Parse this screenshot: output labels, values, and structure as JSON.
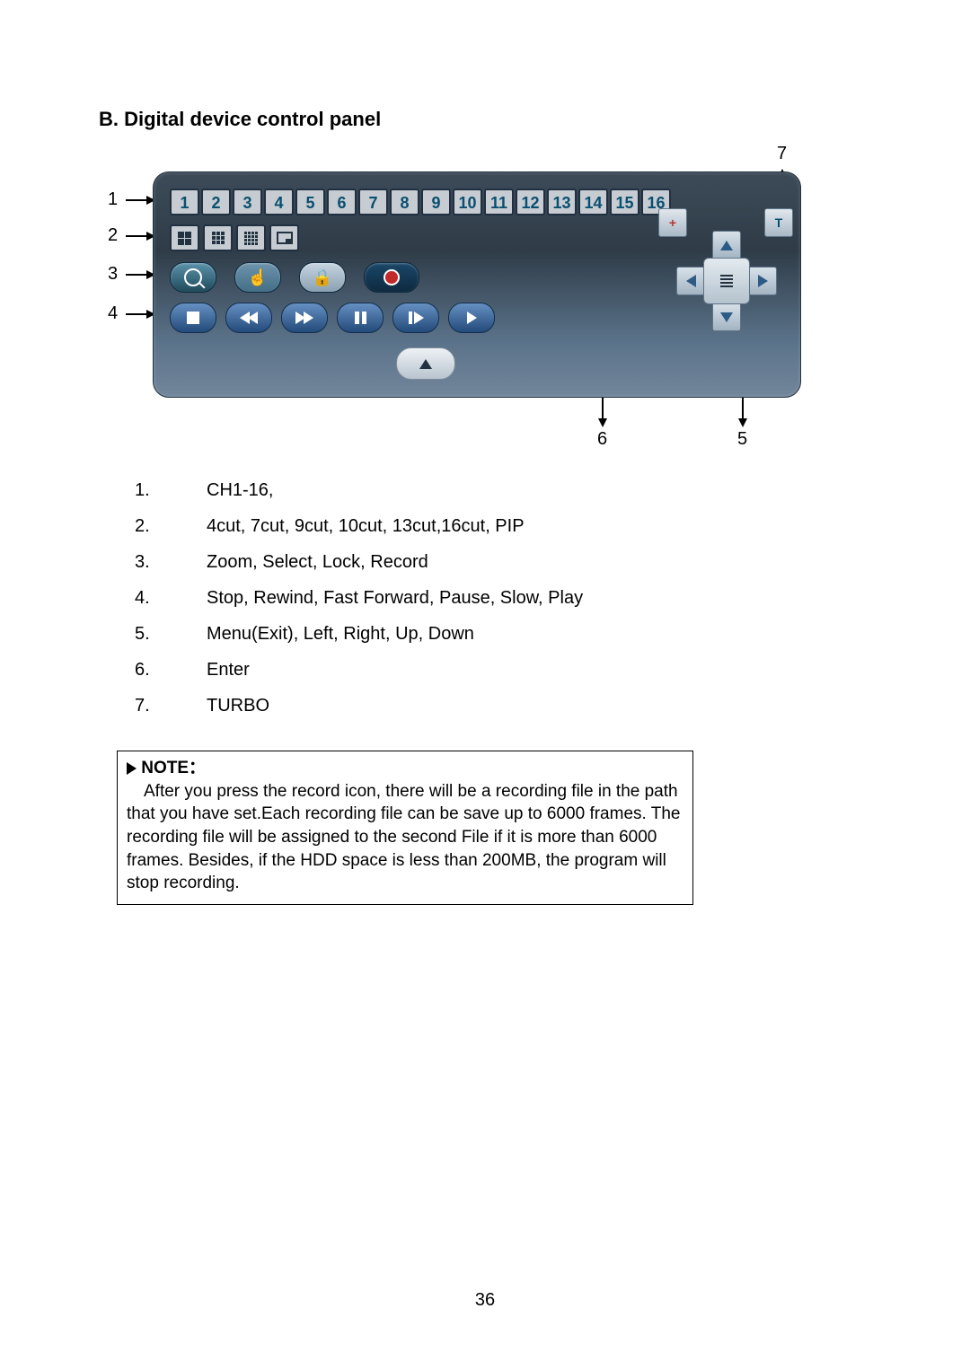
{
  "title": "B. Digital device control panel",
  "annotations": {
    "a1": "1",
    "a2": "2",
    "a3": "3",
    "a4": "4",
    "a5": "5",
    "a6": "6",
    "a7": "7"
  },
  "channels": [
    "1",
    "2",
    "3",
    "4",
    "5",
    "6",
    "7",
    "8",
    "9",
    "10",
    "11",
    "12",
    "13",
    "14",
    "15",
    "16"
  ],
  "turbo_label": "T",
  "plus_label": "+",
  "legend": [
    {
      "n": "1.",
      "t": "CH1-16,"
    },
    {
      "n": "2.",
      "t": "4cut, 7cut, 9cut, 10cut, 13cut,16cut, PIP"
    },
    {
      "n": "3.",
      "t": "Zoom, Select, Lock, Record"
    },
    {
      "n": "4.",
      "t": "Stop, Rewind, Fast Forward, Pause, Slow, Play"
    },
    {
      "n": "5.",
      "t": "Menu(Exit), Left, Right, Up, Down"
    },
    {
      "n": "6.",
      "t": "Enter"
    },
    {
      "n": "7.",
      "t": "TURBO"
    }
  ],
  "note_label": "NOTE：",
  "note_body": "After you press the record icon, there will be a recording file in the path that you have set.Each recording file can be save up to 6000 frames. The recording file will be assigned to the second File if it is more than 6000 frames. Besides, if the HDD space is less than 200MB, the program will stop recording.",
  "page_number": "36"
}
